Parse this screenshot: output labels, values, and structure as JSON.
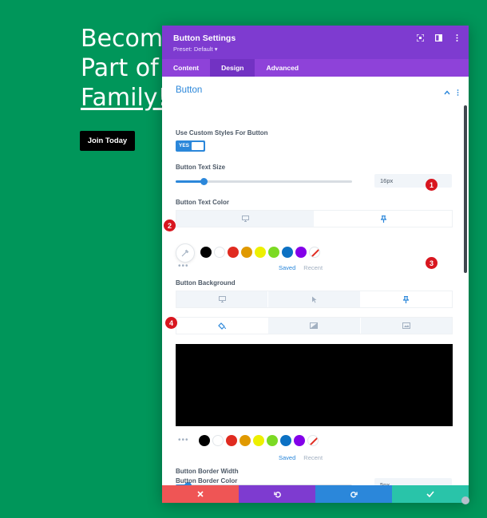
{
  "hero": {
    "line1": "Becom",
    "line2": "Part of",
    "line3": "Family!",
    "button": "Join Today"
  },
  "modal": {
    "title": "Button Settings",
    "preset": "Preset: Default ▾",
    "tabs": [
      "Content",
      "Design",
      "Advanced"
    ],
    "section_title": "Button",
    "custom_styles_label": "Use Custom Styles For Button",
    "toggle_yes": "YES",
    "text_size_label": "Button Text Size",
    "text_size_value": "16px",
    "text_size_level": 0.16,
    "text_color_label": "Button Text Color",
    "background_label": "Button Background",
    "border_width_label": "Button Border Width",
    "border_width_value": "5px",
    "border_width_level": 0.07,
    "border_color_label": "Button Border Color",
    "saved": "Saved",
    "recent": "Recent",
    "more": "•••",
    "swatch_colors": [
      "#000000",
      "#ffffff",
      "#e02b20",
      "#e09900",
      "#edf000",
      "#7cda24",
      "#0c71c3",
      "#8300e9"
    ],
    "footer_colors": [
      "#ef5555",
      "#7e3bd0",
      "#2b87da",
      "#29c4a9"
    ]
  },
  "badges": [
    "1",
    "2",
    "3",
    "4"
  ],
  "colors": {
    "page_bg": "#00965a",
    "accent": "#2b87da",
    "header": "#7e3bd0"
  }
}
